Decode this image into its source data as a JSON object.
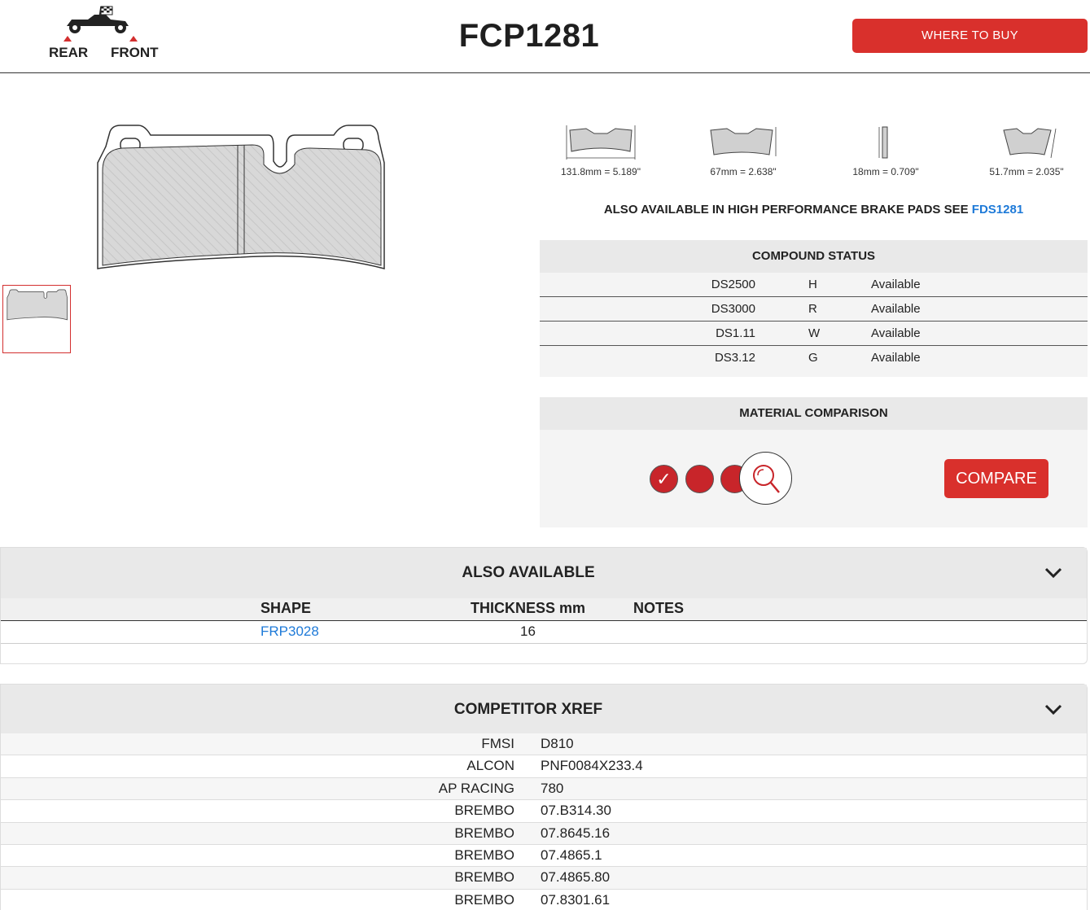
{
  "header": {
    "rear_label": "REAR",
    "front_label": "FRONT",
    "title": "FCP1281",
    "where_to_buy": "WHERE TO BUY"
  },
  "icons": [
    "race-car-icon",
    "chevron-down-icon",
    "magnify-icon",
    "check-icon"
  ],
  "dimensions": [
    {
      "label": "131.8mm = 5.189\""
    },
    {
      "label": "67mm = 2.638\""
    },
    {
      "label": "18mm = 0.709\""
    },
    {
      "label": "51.7mm = 2.035\""
    }
  ],
  "also_hp": {
    "text": "ALSO AVAILABLE IN HIGH PERFORMANCE BRAKE PADS SEE ",
    "link": "FDS1281"
  },
  "compound": {
    "title": "COMPOUND STATUS",
    "rows": [
      {
        "name": "DS2500",
        "code": "H",
        "status": "Available"
      },
      {
        "name": "DS3000",
        "code": "R",
        "status": "Available"
      },
      {
        "name": "DS1.11",
        "code": "W",
        "status": "Available"
      },
      {
        "name": "DS3.12",
        "code": "G",
        "status": "Available"
      }
    ]
  },
  "material": {
    "title": "MATERIAL COMPARISON",
    "check": "✓",
    "compare_label": "COMPARE",
    "accent": "#c8252a"
  },
  "also_available": {
    "title": "ALSO AVAILABLE",
    "columns": [
      "SHAPE",
      "THICKNESS mm",
      "NOTES"
    ],
    "rows": [
      {
        "shape": "FRP3028",
        "thickness": "16",
        "notes": ""
      }
    ]
  },
  "xref": {
    "title": "COMPETITOR XREF",
    "rows": [
      {
        "brand": "FMSI",
        "part": "D810"
      },
      {
        "brand": "ALCON",
        "part": "PNF0084X233.4"
      },
      {
        "brand": "AP RACING",
        "part": "780"
      },
      {
        "brand": "BREMBO",
        "part": "07.B314.30"
      },
      {
        "brand": "BREMBO",
        "part": "07.8645.16"
      },
      {
        "brand": "BREMBO",
        "part": "07.4865.1"
      },
      {
        "brand": "BREMBO",
        "part": "07.4865.80"
      },
      {
        "brand": "BREMBO",
        "part": "07.8301.61"
      }
    ]
  },
  "colors": {
    "brand_red": "#d9302c",
    "link_blue": "#1e7ad8"
  }
}
